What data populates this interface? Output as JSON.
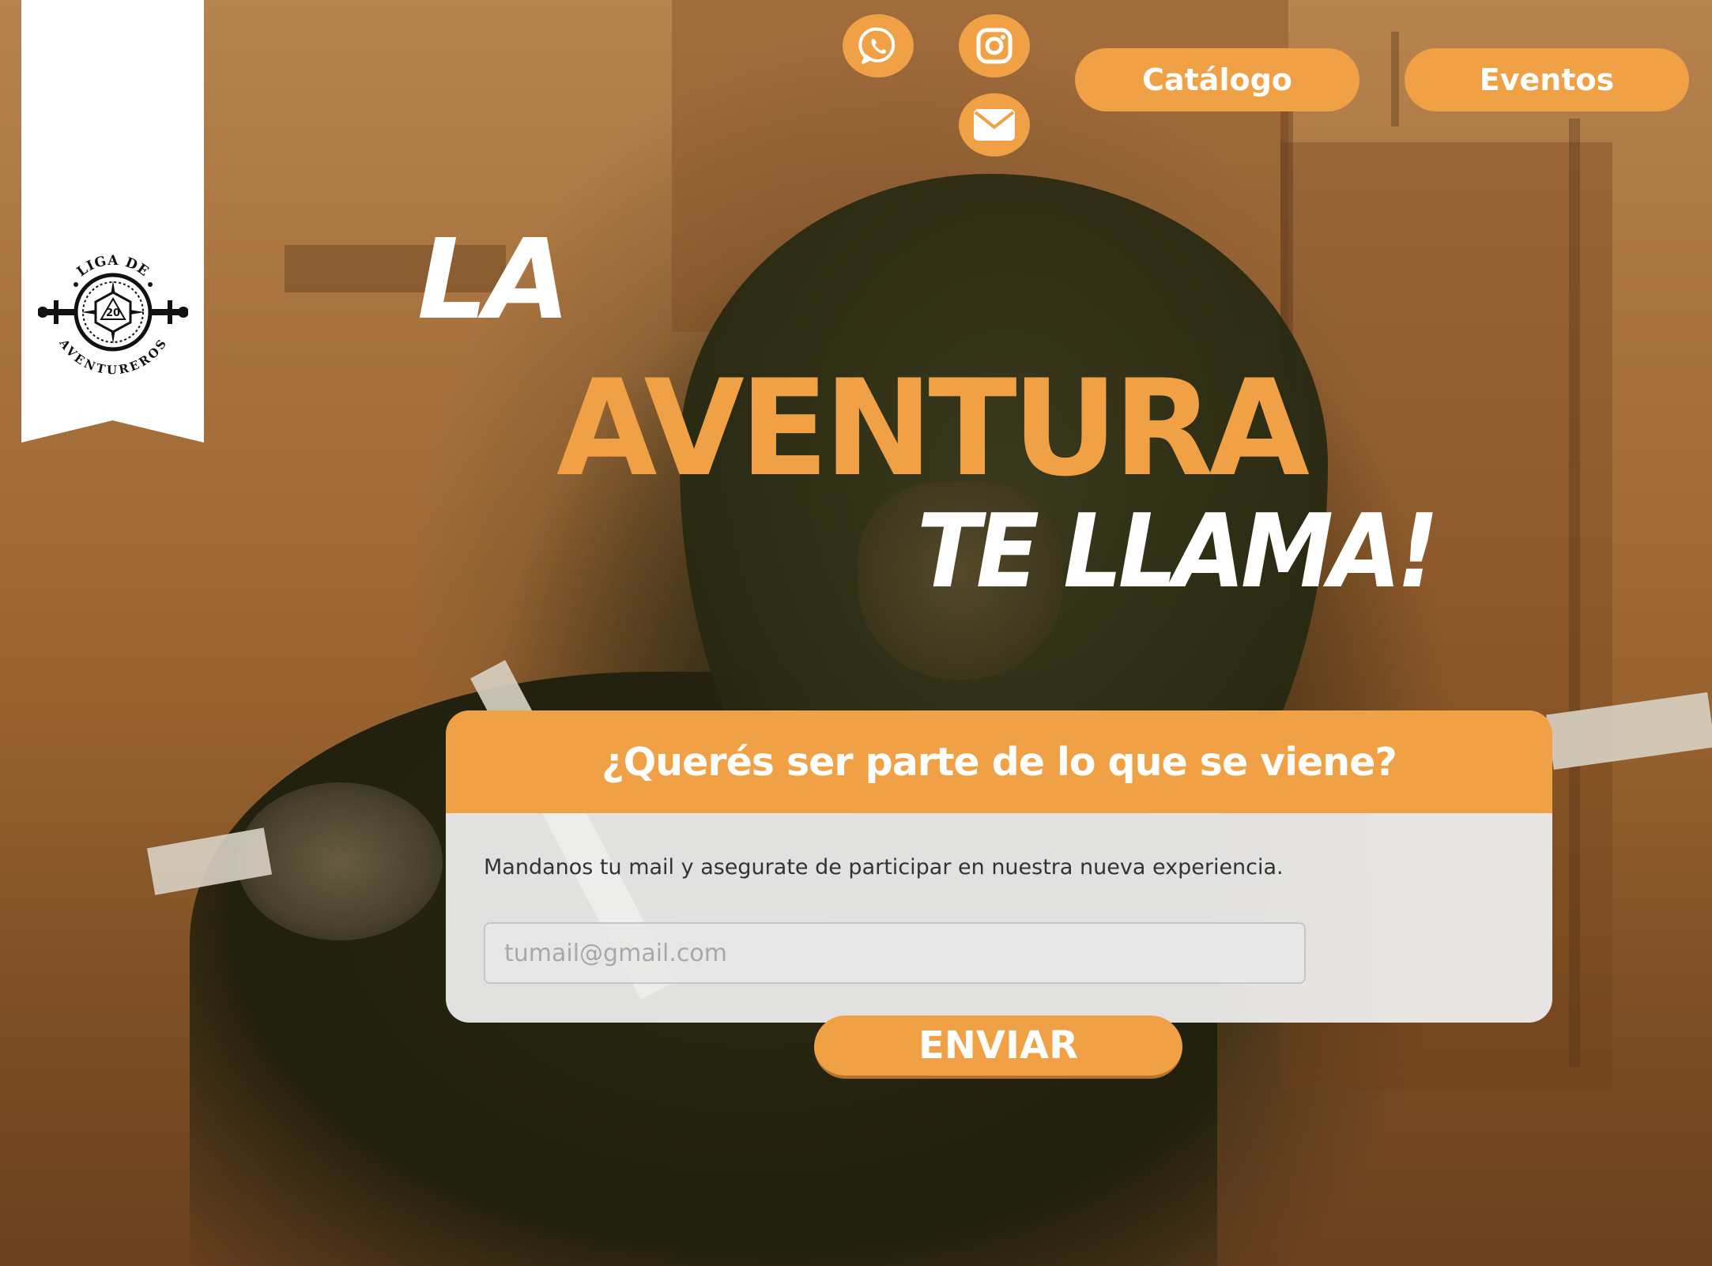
{
  "brand": {
    "logo_text_top": "LIGA DE",
    "logo_text_bottom": "AVENTUREROS",
    "logo_die_value": "20"
  },
  "social": [
    {
      "name": "whatsapp",
      "icon": "whatsapp-icon"
    },
    {
      "name": "instagram",
      "icon": "instagram-icon"
    },
    {
      "name": "email",
      "icon": "mail-icon"
    }
  ],
  "nav": {
    "catalog_label": "Catálogo",
    "events_label": "Eventos"
  },
  "hero": {
    "line1": "LA",
    "line2": "AVENTURA",
    "line3": "TE LLAMA!"
  },
  "signup": {
    "title": "¿Querés ser parte de lo que se viene?",
    "description": "Mandanos tu mail y asegurate de participar en nuestra nueva experiencia.",
    "email_placeholder": "tumail@gmail.com",
    "submit_label": "ENVIAR"
  },
  "colors": {
    "accent": "#f0a045",
    "text_light": "#ffffff"
  }
}
